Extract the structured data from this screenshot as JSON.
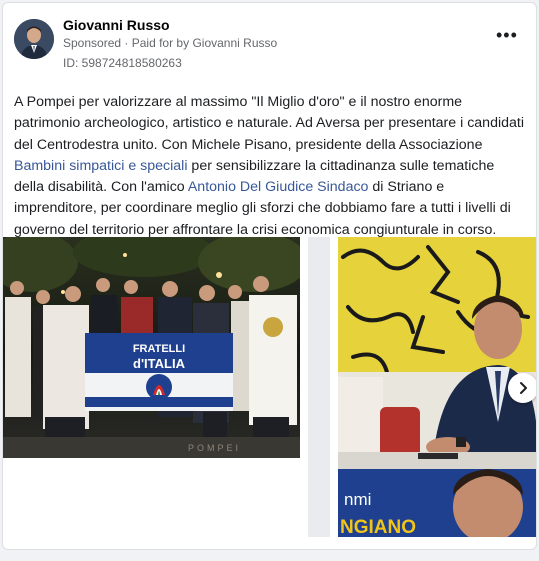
{
  "post": {
    "author": "Giovanni Russo",
    "sponsored_label": "Sponsored",
    "paid_for_prefix": "Paid for by",
    "paid_for_name": "Giovanni Russo",
    "ad_id": "ID: 598724818580263",
    "more_icon": "more-horizontal-icon",
    "text": {
      "part1": "A Pompei per valorizzare al massimo \"Il Miglio d'oro\" e il nostro enorme patrimonio archeologico, artistico e naturale. Ad Aversa per presentare i candidati del Centrodestra unito. Con Michele Pisano, presidente della Associazione ",
      "link1": "Bambini simpatici e speciali",
      "part2": " per sensibilizzare la cittadinanza sulle tematiche della disabilità. Con l'amico ",
      "link2": "Antonio Del Giudice Sindaco",
      "part3": " di Striano e imprenditore, per coordinare meglio gli sforzi che dobbiamo fare a tutti i livelli di governo del territorio per affrontare la crisi economica congiunturale in corso. Che bella…"
    }
  },
  "carousel": {
    "slide1": {
      "flag_line1": "FRATELLI",
      "flag_line2": "d'ITALIA",
      "bottom_text": "POMPEI"
    },
    "slide2": {
      "banner_text1": "nmi",
      "banner_text2": "NGIANO"
    },
    "next_icon": "chevron-right-icon"
  },
  "colors": {
    "link": "#385898",
    "text": "#1c1e21",
    "muted": "#65676b",
    "brand_blue": "#1f3f8f",
    "yellow": "#e6d23a"
  }
}
